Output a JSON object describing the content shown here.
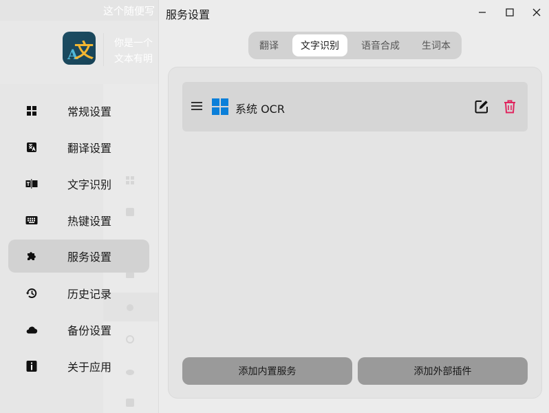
{
  "background_window": {
    "title": "这个随便写",
    "description_line1": "你是一个",
    "description_line2": "文本有明"
  },
  "sidebar": {
    "items": [
      {
        "label": "常规设置",
        "icon": "grid-icon"
      },
      {
        "label": "翻译设置",
        "icon": "translate-icon"
      },
      {
        "label": "文字识别",
        "icon": "ocr-icon"
      },
      {
        "label": "热键设置",
        "icon": "keyboard-icon"
      },
      {
        "label": "服务设置",
        "icon": "puzzle-icon"
      },
      {
        "label": "历史记录",
        "icon": "history-icon"
      },
      {
        "label": "备份设置",
        "icon": "cloud-icon"
      },
      {
        "label": "关于应用",
        "icon": "info-icon"
      }
    ],
    "active_index": 4
  },
  "window": {
    "title": "服务设置",
    "controls": {
      "minimize": "minimize-icon",
      "maximize": "maximize-icon",
      "close": "close-icon"
    }
  },
  "tabs": {
    "items": [
      "翻译",
      "文字识别",
      "语音合成",
      "生词本"
    ],
    "active_index": 1
  },
  "services": [
    {
      "name": "系统 OCR",
      "icon": "windows-logo-icon"
    }
  ],
  "buttons": {
    "add_builtin": "添加内置服务",
    "add_plugin": "添加外部插件"
  },
  "colors": {
    "delete_icon": "#e0245e",
    "windows_blue": "#0a7fd9",
    "active_nav_bg": "#d2d2d2",
    "bottom_button_bg": "#9a9a9a"
  }
}
